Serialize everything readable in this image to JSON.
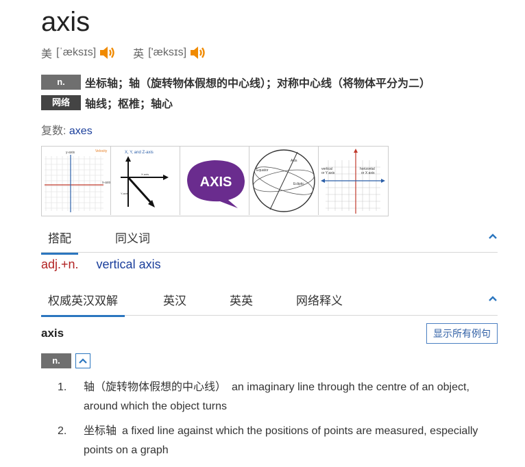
{
  "headword": "axis",
  "pronunciations": [
    {
      "region": "美",
      "ipa": "[ˈæksɪs]"
    },
    {
      "region": "英",
      "ipa": "['æksɪs]"
    }
  ],
  "definitions": [
    {
      "tag": "n.",
      "text": "坐标轴；轴（旋转物体假想的中心线）；对称中心线（将物体平分为二）"
    },
    {
      "tag": "网络",
      "text": "轴线；枢椎；轴心"
    }
  ],
  "plural": {
    "label": "复数:",
    "value": "axes"
  },
  "thumbnails": [
    {
      "name": "coordinate-grid",
      "texts": [
        "y-axis",
        "x-axis",
        "Velocity"
      ]
    },
    {
      "name": "xyz-axis",
      "texts": [
        "X, Y, and Z-axis",
        "X-axis",
        "Y-axis"
      ]
    },
    {
      "name": "axis-logo",
      "texts": [
        "AXIS"
      ]
    },
    {
      "name": "sphere-axis",
      "texts": [
        "Axis",
        "Equator",
        "Ecliptic"
      ]
    },
    {
      "name": "vertical-horizontal-axis",
      "texts": [
        "vertical",
        "or Y axis",
        "horizontal",
        "or X axis"
      ]
    }
  ],
  "tabs1": {
    "items": [
      "搭配",
      "同义词"
    ],
    "active": 0
  },
  "collocation": {
    "pos": "adj.+n.",
    "phrase": "vertical axis"
  },
  "tabs2": {
    "items": [
      "权威英汉双解",
      "英汉",
      "英英",
      "网络释义"
    ],
    "active": 0
  },
  "bilingual": {
    "word": "axis",
    "show_examples_label": "显示所有例句",
    "pos": "n.",
    "senses": [
      {
        "num": "1.",
        "zh": "轴（旋转物体假想的中心线）",
        "en": "an imaginary line through the centre of an object, around which the object turns"
      },
      {
        "num": "2.",
        "zh": "坐标轴",
        "en": "a fixed line against which the positions of points are measured, especially points on a graph"
      }
    ]
  },
  "colors": {
    "accent": "#2b76bf",
    "link": "#1a3e9b",
    "pos_red": "#b22222",
    "speaker": "#f08a00"
  }
}
